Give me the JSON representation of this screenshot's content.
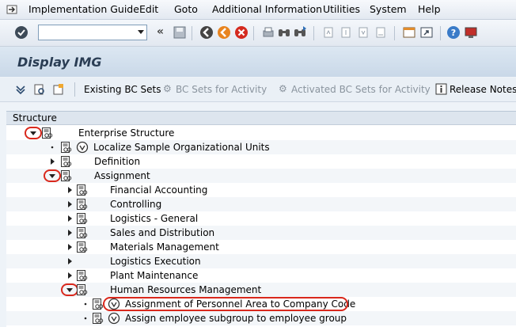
{
  "menu": {
    "items": [
      "Implementation Guide",
      "Edit",
      "Goto",
      "Additional Information",
      "Utilities",
      "System",
      "Help"
    ]
  },
  "toolbar": {
    "command_field_value": "",
    "icons": [
      "enter-icon",
      "back-icon",
      "save-icon",
      "back-nav-icon",
      "exit-icon",
      "cancel-icon",
      "print-icon",
      "find-icon",
      "find-next-icon",
      "first-page-icon",
      "previous-page-icon",
      "next-page-icon",
      "last-page-icon",
      "create-session-icon",
      "shortcut-icon",
      "help-icon",
      "customize-layout-icon"
    ]
  },
  "title": "Display IMG",
  "app_toolbar": {
    "existing_bc_sets": "Existing BC Sets",
    "bc_sets_for_activity": "BC Sets for Activity",
    "activated_bc_sets": "Activated BC Sets for Activity",
    "release_notes": "Release Notes"
  },
  "tree": {
    "header": "Structure",
    "rows": [
      {
        "label": "Enterprise Structure",
        "level": 0,
        "state": "expanded",
        "circled": true
      },
      {
        "label": "Localize Sample Organizational Units",
        "level": 1,
        "state": "leaf",
        "executable": true
      },
      {
        "label": "Definition",
        "level": 1,
        "state": "collapsed"
      },
      {
        "label": "Assignment",
        "level": 1,
        "state": "expanded",
        "circled": true
      },
      {
        "label": "Financial Accounting",
        "level": 2,
        "state": "collapsed"
      },
      {
        "label": "Controlling",
        "level": 2,
        "state": "collapsed"
      },
      {
        "label": "Logistics - General",
        "level": 2,
        "state": "collapsed"
      },
      {
        "label": "Sales and Distribution",
        "level": 2,
        "state": "collapsed"
      },
      {
        "label": "Materials Management",
        "level": 2,
        "state": "collapsed"
      },
      {
        "label": "Logistics Execution",
        "level": 2,
        "state": "collapsed-noicon"
      },
      {
        "label": "Plant Maintenance",
        "level": 2,
        "state": "collapsed"
      },
      {
        "label": "Human Resources Management",
        "level": 2,
        "state": "expanded",
        "circled": true
      },
      {
        "label": "Assignment of Personnel Area to Company Code",
        "level": 3,
        "state": "leaf",
        "executable": true,
        "highlighted": true
      },
      {
        "label": "Assign employee subgroup to employee group",
        "level": 3,
        "state": "leaf",
        "executable": true
      }
    ]
  },
  "colors": {
    "highlight_oval": "#d9281c",
    "title_text": "#2a3d54"
  }
}
